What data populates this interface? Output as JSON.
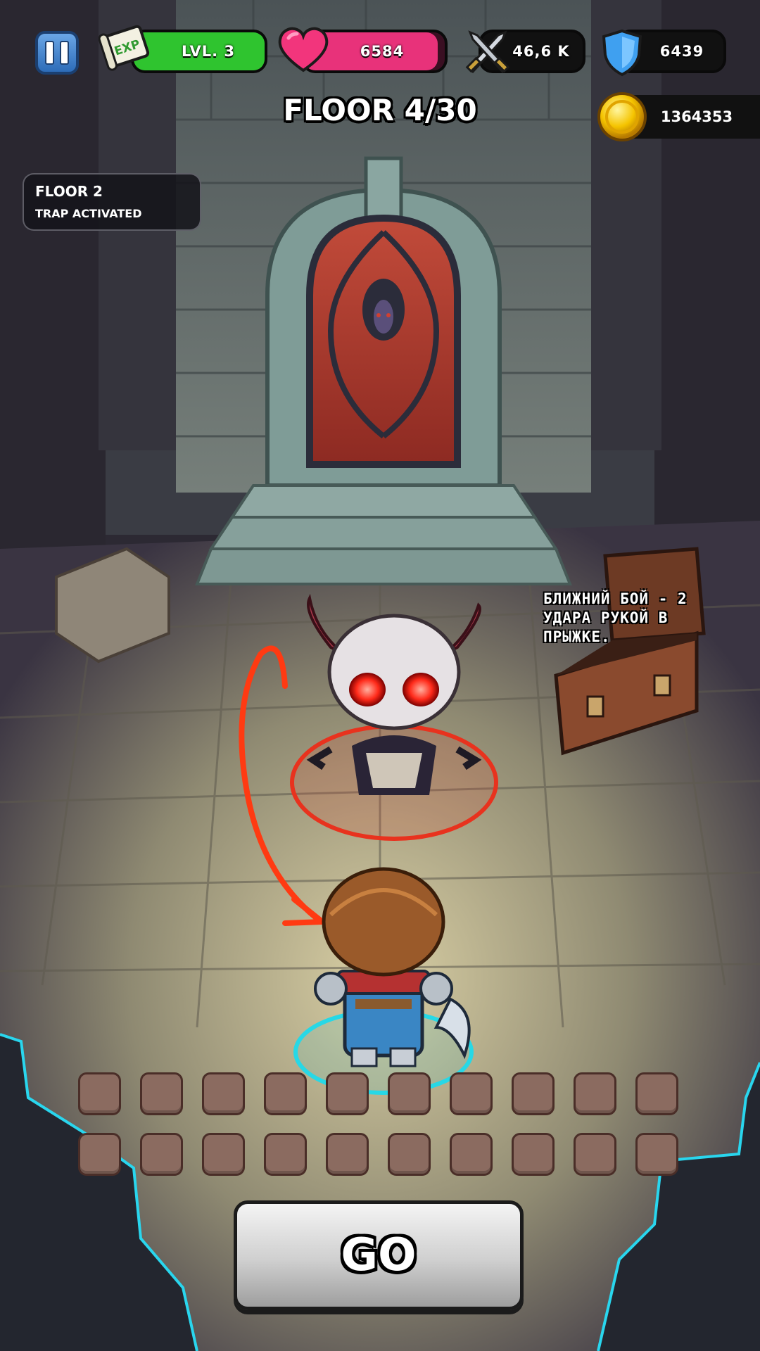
{
  "hud": {
    "level": {
      "label": "LVL. 3",
      "exp_icon_text": "EXP",
      "fill_fraction": 1.0
    },
    "health": {
      "value": "6584",
      "fill_fraction": 0.95
    },
    "attack": {
      "value": "46,6 K"
    },
    "defense": {
      "value": "6439"
    },
    "gold": {
      "value": "1364353"
    }
  },
  "floor_title": "FLOOR 4/30",
  "info_panel": {
    "title": "FLOOR 2",
    "subtitle": "TRAP ACTIVATED"
  },
  "annotation": {
    "text": "БЛИЖНИЙ БОЙ - 2 УДАРА РУКОЙ В ПРЫЖКЕ."
  },
  "inventory": {
    "rows": 2,
    "slots_per_row": 10
  },
  "go_button": {
    "label": "GO"
  },
  "colors": {
    "exp_fill": "#2fc42f",
    "health_fill": "#e8327a",
    "enemy_ring": "#e8321e",
    "hero_ring": "#27d8e6",
    "go_button": "#d9d9d9",
    "slot": "#8b6b60"
  },
  "icons": [
    "pause-icon",
    "exp-scroll-icon",
    "heart-icon",
    "crossed-swords-icon",
    "shield-icon",
    "gold-coin-icon"
  ]
}
